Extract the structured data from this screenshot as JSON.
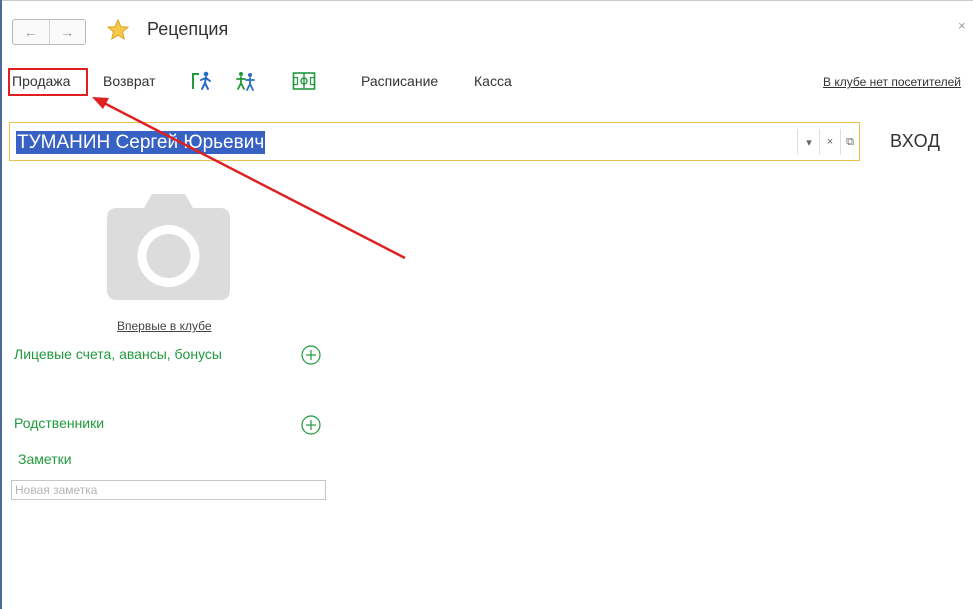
{
  "window": {
    "title": "Рецепция",
    "close_glyph": "×",
    "nav": {
      "back_glyph": "←",
      "forward_glyph": "→"
    }
  },
  "toolbar": {
    "sale_label": "Продажа",
    "return_label": "Возврат",
    "schedule_label": "Расписание",
    "cash_label": "Касса",
    "club_status_link": "В клубе нет посетителей",
    "icons": [
      "person-enter-icon",
      "group-people-icon",
      "court-layout-icon"
    ]
  },
  "client": {
    "name": "ТУМАНИН Сергей Юрьевич",
    "dropdown_glyph": "▾",
    "clear_glyph": "×",
    "open_glyph": "⧉",
    "enter_label": "ВХОД"
  },
  "profile": {
    "photo_icon": "camera-icon",
    "first_visit_label": "Впервые в клубе"
  },
  "sections": {
    "accounts_label": "Лицевые счета, авансы, бонусы",
    "relatives_label": "Родственники",
    "notes_label": "Заметки",
    "note_placeholder": "Новая заметка"
  },
  "colors": {
    "accent_green": "#1f9a3c",
    "selection_blue": "#3861c4",
    "highlight_red": "#e02020",
    "field_border": "#e8c04a"
  }
}
